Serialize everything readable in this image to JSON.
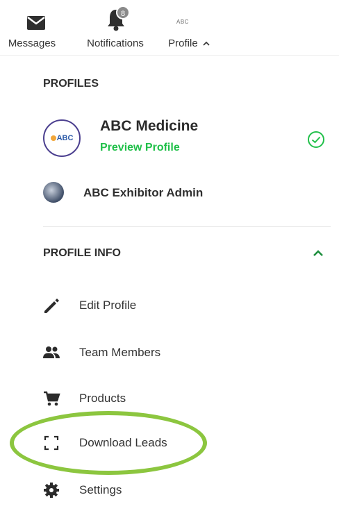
{
  "topnav": {
    "messages": {
      "label": "Messages",
      "icon": "mail-icon"
    },
    "notifications": {
      "label": "Notifications",
      "icon": "bell-icon",
      "badge": "8"
    },
    "profile": {
      "label": "Profile",
      "icon": "chevron-up-icon",
      "mini_logo": "ABC"
    }
  },
  "profiles": {
    "title": "PROFILES",
    "items": [
      {
        "name": "ABC Medicine",
        "action": "Preview Profile",
        "selected": true,
        "logo_text": "ABC"
      },
      {
        "name": "ABC Exhibitor Admin"
      }
    ]
  },
  "profile_info": {
    "title": "PROFILE INFO",
    "expanded": true,
    "items": [
      {
        "label": "Edit Profile",
        "icon": "pencil-icon"
      },
      {
        "label": "Team Members",
        "icon": "people-icon"
      },
      {
        "label": "Products",
        "icon": "cart-icon"
      },
      {
        "label": "Download Leads",
        "icon": "scan-frame-icon"
      },
      {
        "label": "Settings",
        "icon": "gear-icon"
      }
    ]
  },
  "colors": {
    "accent_green": "#21c04a",
    "highlight_ring": "#8cc63f",
    "chevron_green": "#1f8f3f",
    "text_dark": "#2b2b2b"
  }
}
